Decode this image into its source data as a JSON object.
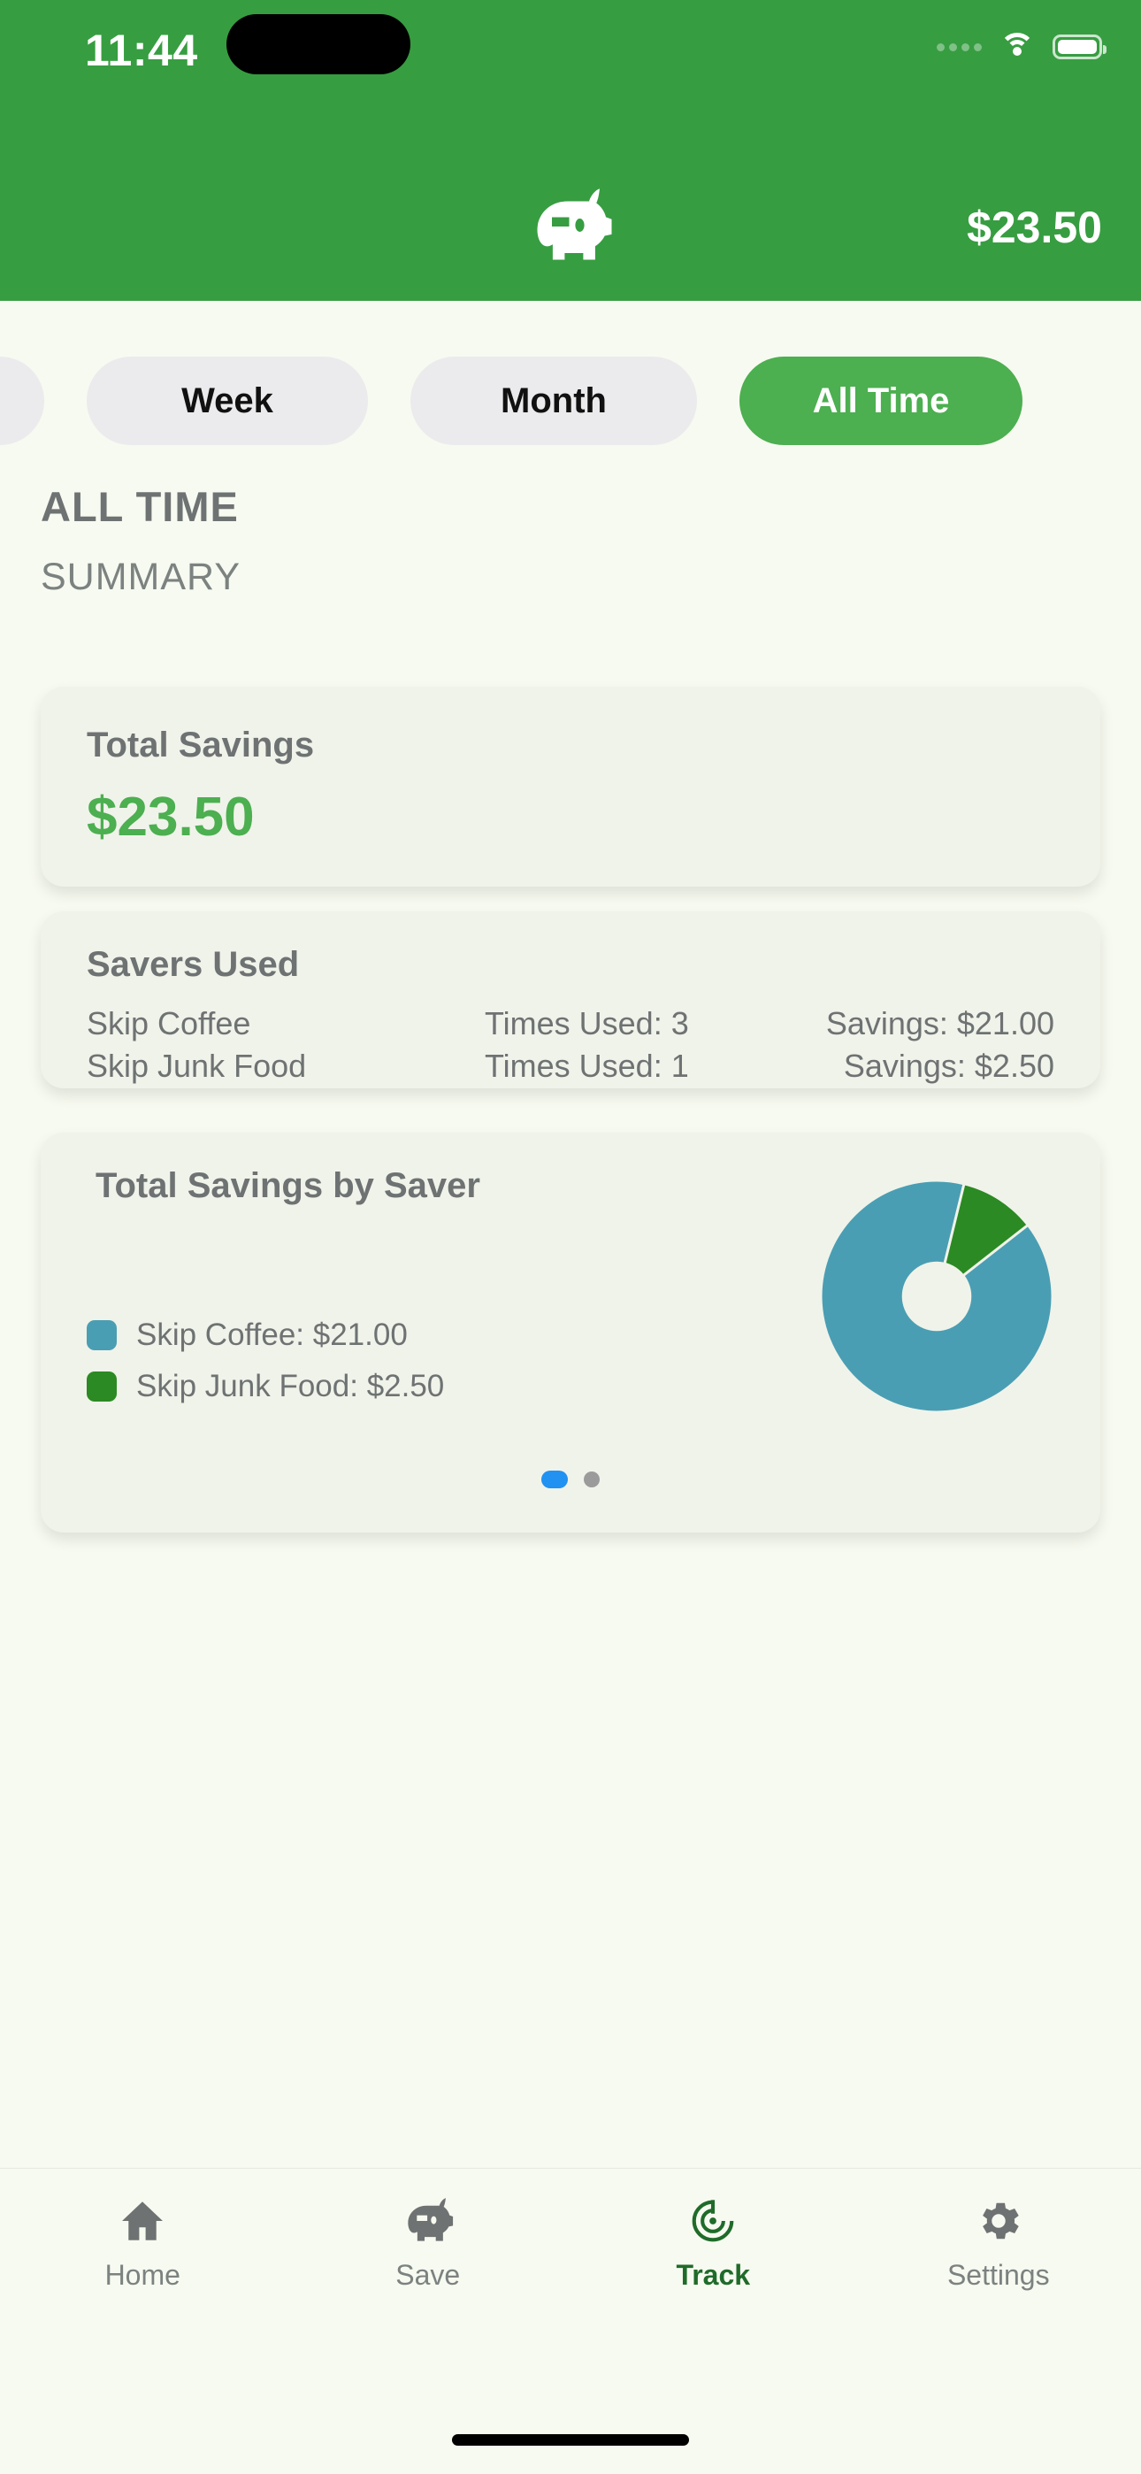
{
  "status_bar": {
    "time": "11:44",
    "signal_icon": "signal-dots-icon",
    "wifi_icon": "wifi-icon",
    "battery_icon": "battery-icon"
  },
  "app_header": {
    "logo_icon": "piggy-bank-icon",
    "balance": "$23.50"
  },
  "period_tabs": {
    "items": [
      {
        "label": "",
        "active": false
      },
      {
        "label": "Week",
        "active": false
      },
      {
        "label": "Month",
        "active": false
      },
      {
        "label": "All Time",
        "active": true
      }
    ],
    "active_color": "#4CAF50",
    "inactive_color": "#EBEBED"
  },
  "section": {
    "title": "ALL TIME",
    "subtitle": "SUMMARY"
  },
  "total_savings_card": {
    "title": "Total Savings",
    "amount": "$23.50",
    "amount_color": "#4CAF50"
  },
  "savers_used_card": {
    "title": "Savers Used",
    "rows": [
      {
        "name": "Skip Coffee",
        "times_used": "Times Used: 3",
        "savings": "Savings: $21.00"
      },
      {
        "name": "Skip Junk Food",
        "times_used": "Times Used: 1",
        "savings": "Savings: $2.50"
      }
    ]
  },
  "chart_card": {
    "title": "Total Savings by Saver",
    "legend": [
      {
        "label": "Skip Coffee: $21.00",
        "color": "#4A9EB3"
      },
      {
        "label": "Skip Junk Food: $2.50",
        "color": "#2B8A23"
      }
    ],
    "pagination": {
      "total": 2,
      "active_index": 0,
      "active_color": "#2191F2",
      "inactive_color": "#9B9B9B"
    }
  },
  "chart_data": {
    "type": "pie",
    "title": "Total Savings by Saver",
    "categories": [
      "Skip Coffee",
      "Skip Junk Food"
    ],
    "values": [
      21.0,
      2.5
    ],
    "value_labels": [
      "$21.00",
      "$2.50"
    ],
    "percentages": [
      89.4,
      10.6
    ],
    "colors": [
      "#4A9EB3",
      "#2B8A23"
    ],
    "donut": true,
    "inner_radius_ratio": 0.3,
    "start_angle_deg": -38,
    "legend_position": "left",
    "xlabel": "",
    "ylabel": ""
  },
  "bottom_nav": {
    "items": [
      {
        "label": "Home",
        "icon": "home-icon",
        "active": false
      },
      {
        "label": "Save",
        "icon": "piggy-bank-icon",
        "active": false
      },
      {
        "label": "Track",
        "icon": "target-icon",
        "active": true
      },
      {
        "label": "Settings",
        "icon": "gear-icon",
        "active": false
      }
    ],
    "active_color": "#1F6B2A",
    "inactive_color": "#7C8280"
  }
}
